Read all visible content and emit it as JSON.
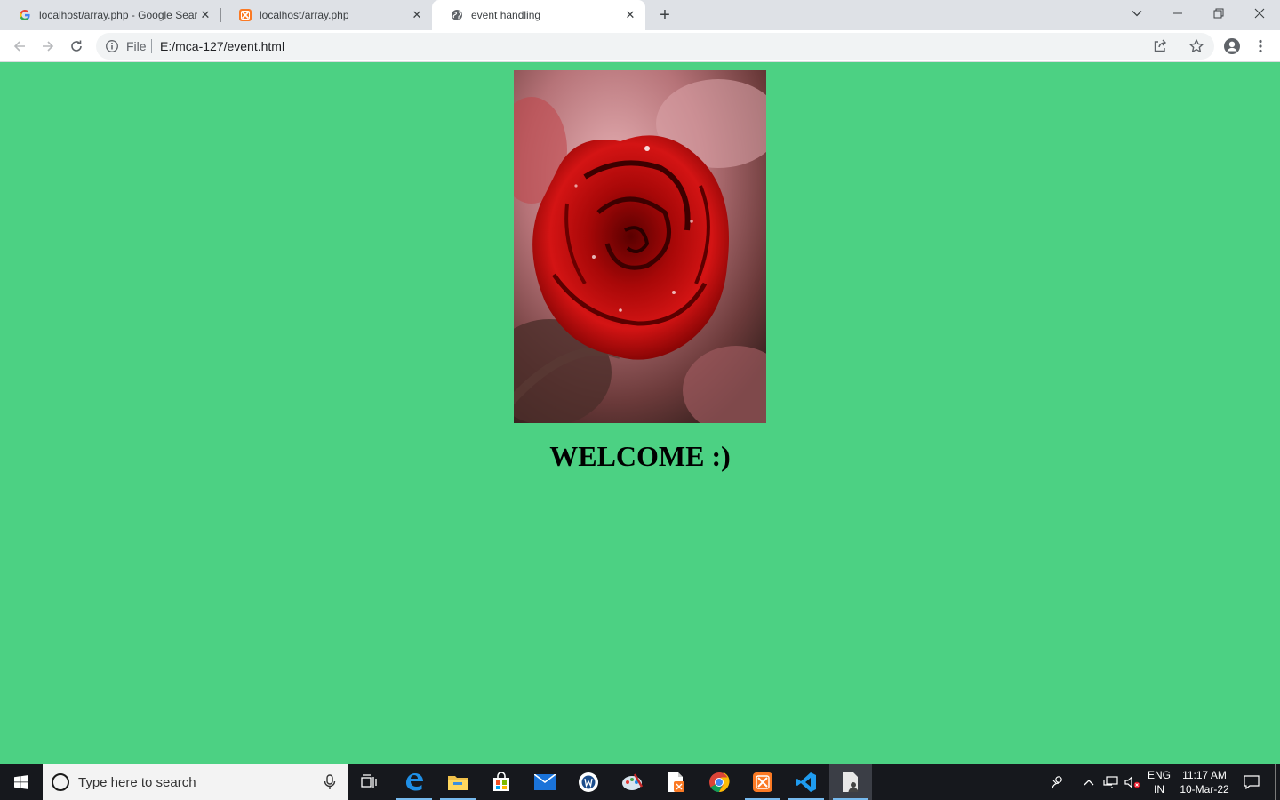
{
  "browser": {
    "tabs": [
      {
        "title": "localhost/array.php - Google Search",
        "favicon": "google-icon"
      },
      {
        "title": "localhost/array.php",
        "favicon": "xampp-icon"
      },
      {
        "title": "event handling",
        "favicon": "globe-icon",
        "active": true
      }
    ],
    "address": {
      "scheme_label": "File",
      "url": "E:/mca-127/event.html"
    }
  },
  "page": {
    "background_color": "#4cd183",
    "image_alt": "red rose",
    "heading": "WELCOME :)"
  },
  "taskbar": {
    "search_placeholder": "Type here to search",
    "apps": [
      "task-view-icon",
      "edge-icon",
      "file-explorer-icon",
      "store-icon",
      "mail-icon",
      "writer-icon",
      "paint-icon",
      "xampp-doc-icon",
      "chrome-icon",
      "xampp-icon",
      "vscode-icon",
      "user-doc-icon"
    ],
    "language": {
      "line1": "ENG",
      "line2": "IN"
    },
    "clock": {
      "time": "11:17 AM",
      "date": "10-Mar-22"
    }
  }
}
